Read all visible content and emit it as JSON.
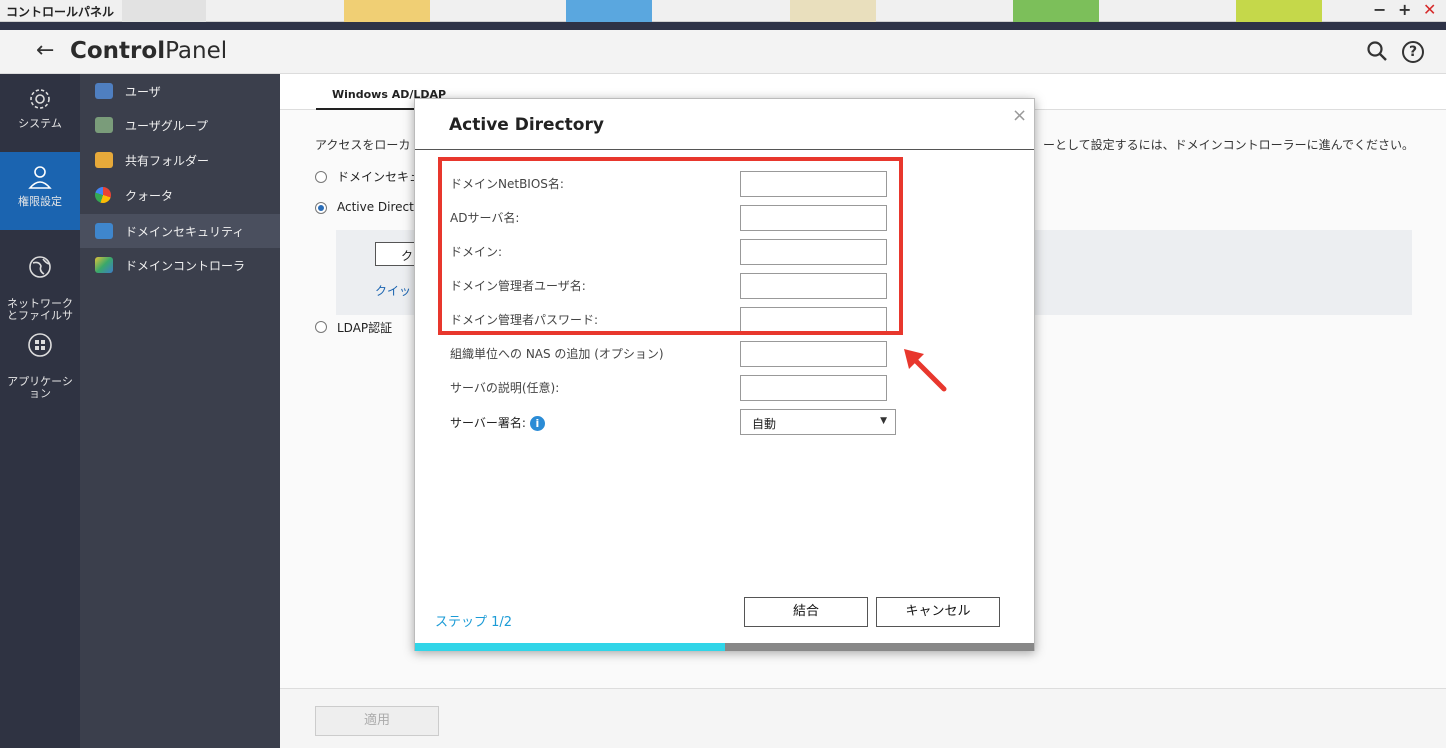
{
  "window": {
    "title": "コントロールパネル",
    "minimize": "−",
    "maximize": "+",
    "close": "✕"
  },
  "header": {
    "app_name_bold": "Control",
    "app_name_rest": "Panel",
    "back": "←",
    "help": "?"
  },
  "nav_primary": [
    {
      "label": "システム",
      "icon": "gear-icon",
      "active": false
    },
    {
      "label": "権限設定",
      "icon": "user-icon",
      "active": true
    },
    {
      "label": "ネットワーク\nとファイルサ",
      "icon": "globe-icon",
      "active": false
    },
    {
      "label": "アプリケーシ\nョン",
      "icon": "apps-icon",
      "active": false
    }
  ],
  "nav_secondary": [
    {
      "label": "ユーザ",
      "icon": "user-icon"
    },
    {
      "label": "ユーザグループ",
      "icon": "user-group-icon"
    },
    {
      "label": "共有フォルダー",
      "icon": "shared-folder-icon"
    },
    {
      "label": "クォータ",
      "icon": "quota-icon"
    },
    {
      "label": "ドメインセキュリティ",
      "icon": "domain-security-icon",
      "active": true
    },
    {
      "label": "ドメインコントローラ",
      "icon": "domain-controller-icon"
    }
  ],
  "main": {
    "tab": "Windows AD/LDAP",
    "desc_left": "アクセスをローカ",
    "desc_right": "ーとして設定するには、ドメインコントローラーに進んでください。",
    "radios": [
      {
        "label": "ドメインセキュ",
        "checked": false
      },
      {
        "label": "Active Director",
        "checked": true
      },
      {
        "label": "LDAP認証",
        "checked": false
      }
    ],
    "bg_button": "ク",
    "bg_link": "クイッ",
    "apply": "適用"
  },
  "dialog": {
    "title": "Active Directory",
    "close": "×",
    "fields": [
      {
        "label": "ドメインNetBIOS名:",
        "value": ""
      },
      {
        "label": "ADサーバ名:",
        "value": ""
      },
      {
        "label": "ドメイン:",
        "value": ""
      },
      {
        "label": "ドメイン管理者ユーザ名:",
        "value": ""
      },
      {
        "label": "ドメイン管理者パスワード:",
        "value": ""
      },
      {
        "label": "組織単位への NAS の追加 (オプション)",
        "value": ""
      },
      {
        "label": "サーバの説明(任意):",
        "value": ""
      }
    ],
    "signature_label": "サーバー署名:",
    "info": "i",
    "signature_value": "自動",
    "step": "ステップ 1/2",
    "join": "結合",
    "cancel": "キャンセル",
    "progress_fraction": 0.5
  },
  "colors": {
    "accent": "#1b64b0",
    "highlight": "#e8372d",
    "progress": "#30d5e8"
  }
}
